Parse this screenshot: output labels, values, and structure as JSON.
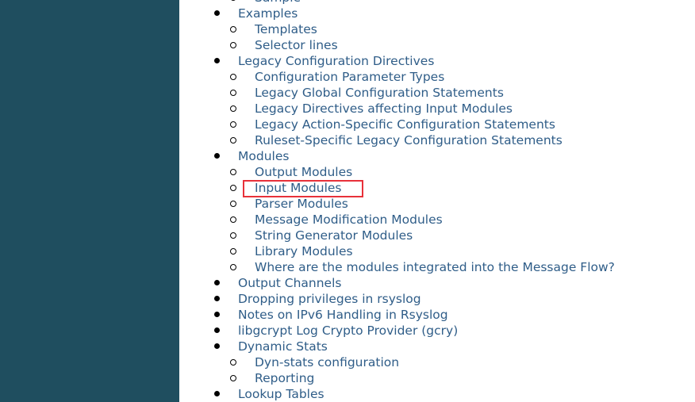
{
  "sidebar": {
    "color": "#1f4e5f"
  },
  "highlight": {
    "color": "#e8313a",
    "item": "Input Modules"
  },
  "toc": [
    {
      "level": 2,
      "label": "Sample"
    },
    {
      "level": 1,
      "label": "Examples"
    },
    {
      "level": 2,
      "label": "Templates"
    },
    {
      "level": 2,
      "label": "Selector lines"
    },
    {
      "level": 1,
      "label": "Legacy Configuration Directives"
    },
    {
      "level": 2,
      "label": "Configuration Parameter Types"
    },
    {
      "level": 2,
      "label": "Legacy Global Configuration Statements"
    },
    {
      "level": 2,
      "label": "Legacy Directives affecting Input Modules"
    },
    {
      "level": 2,
      "label": "Legacy Action-Specific Configuration Statements"
    },
    {
      "level": 2,
      "label": "Ruleset-Specific Legacy Configuration Statements"
    },
    {
      "level": 1,
      "label": "Modules"
    },
    {
      "level": 2,
      "label": "Output Modules"
    },
    {
      "level": 2,
      "label": "Input Modules"
    },
    {
      "level": 2,
      "label": "Parser Modules"
    },
    {
      "level": 2,
      "label": "Message Modification Modules"
    },
    {
      "level": 2,
      "label": "String Generator Modules"
    },
    {
      "level": 2,
      "label": "Library Modules"
    },
    {
      "level": 2,
      "label": "Where are the modules integrated into the Message Flow?"
    },
    {
      "level": 1,
      "label": "Output Channels"
    },
    {
      "level": 1,
      "label": "Dropping privileges in rsyslog"
    },
    {
      "level": 1,
      "label": "Notes on IPv6 Handling in Rsyslog"
    },
    {
      "level": 1,
      "label": "libgcrypt Log Crypto Provider (gcry)"
    },
    {
      "level": 1,
      "label": "Dynamic Stats"
    },
    {
      "level": 2,
      "label": "Dyn-stats configuration"
    },
    {
      "level": 2,
      "label": "Reporting"
    },
    {
      "level": 1,
      "label": "Lookup Tables"
    }
  ]
}
